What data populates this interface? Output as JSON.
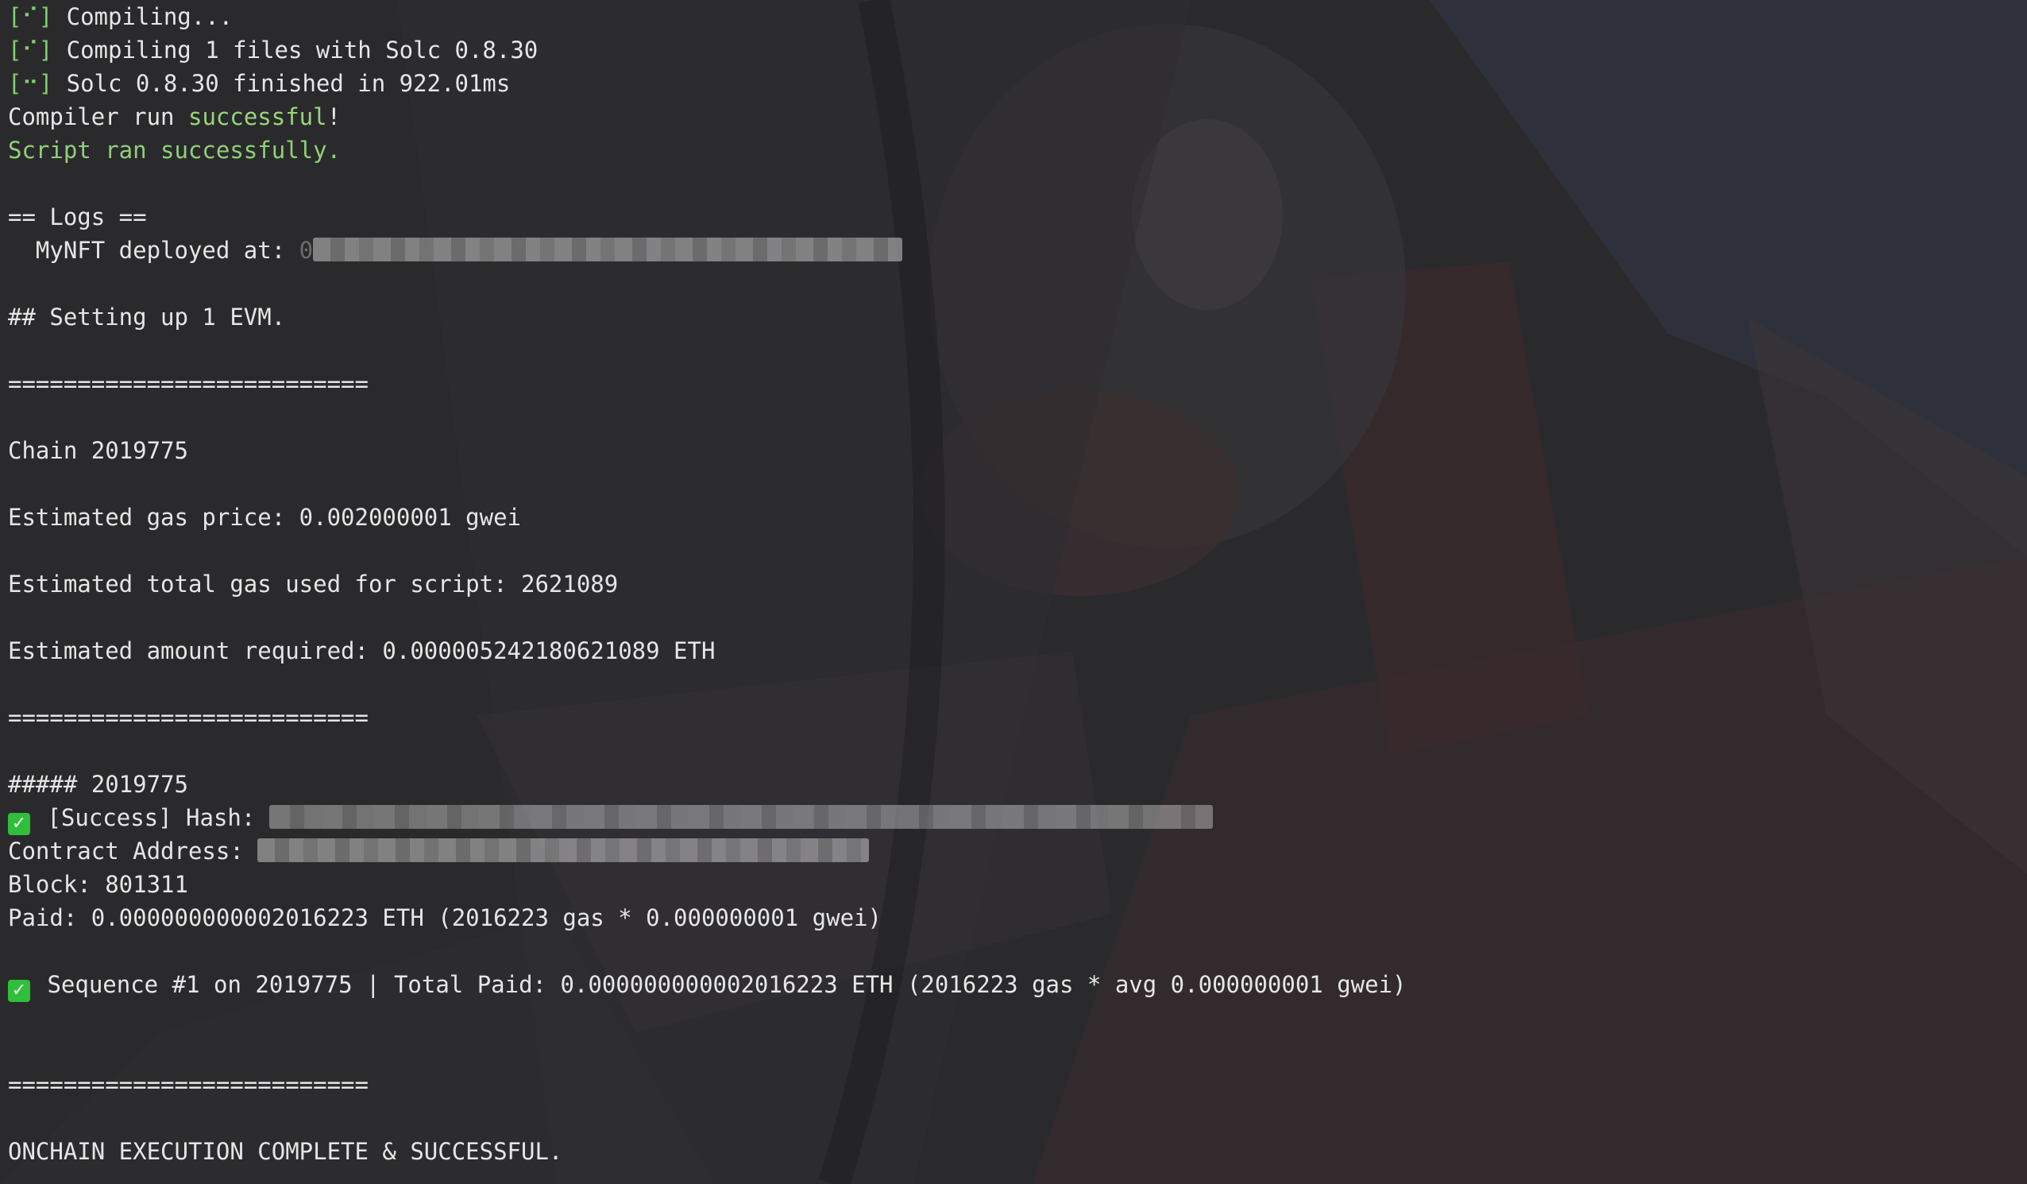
{
  "terminal": {
    "lines": {
      "compiling": {
        "spinner": "[⠊]",
        "text": " Compiling..."
      },
      "compiling_files": {
        "spinner": "[⠊]",
        "text": " Compiling 1 files with Solc 0.8.30"
      },
      "solc_finished": {
        "spinner": "[⠒]",
        "text": " Solc 0.8.30 finished in 922.01ms"
      },
      "compiler_run": {
        "prefix": "Compiler run ",
        "highlight": "successful",
        "suffix": "!"
      },
      "script_ran": "Script ran successfully.",
      "logs_header": "== Logs ==",
      "deployed_label": "  MyNFT deployed at: ",
      "deployed_visible_prefix": "0",
      "setting_up": "## Setting up 1 EVM.",
      "separator": "==========================",
      "chain": "Chain 2019775",
      "gas_price": "Estimated gas price: 0.002000001 gwei",
      "total_gas": "Estimated total gas used for script: 2621089",
      "amount_required": "Estimated amount required: 0.000005242180621089 ETH",
      "chain_header": "##### 2019775",
      "success_hash_label": " [Success] Hash: ",
      "contract_address_label": "Contract Address: ",
      "block": "Block: 801311",
      "paid": "Paid: 0.000000000002016223 ETH (2016223 gas * 0.000000001 gwei)",
      "sequence": "Sequence #1 on 2019775 | Total Paid: 0.000000000002016223 ETH (2016223 gas * avg 0.000000001 gwei)",
      "complete": "ONCHAIN EXECUTION COMPLETE & SUCCESSFUL."
    },
    "colors": {
      "text": "#e6e6e6",
      "success_green": "#98d67a",
      "check_green": "#2fbf3a"
    }
  },
  "icons": {
    "check": "white-check-mark-in-green-box"
  }
}
